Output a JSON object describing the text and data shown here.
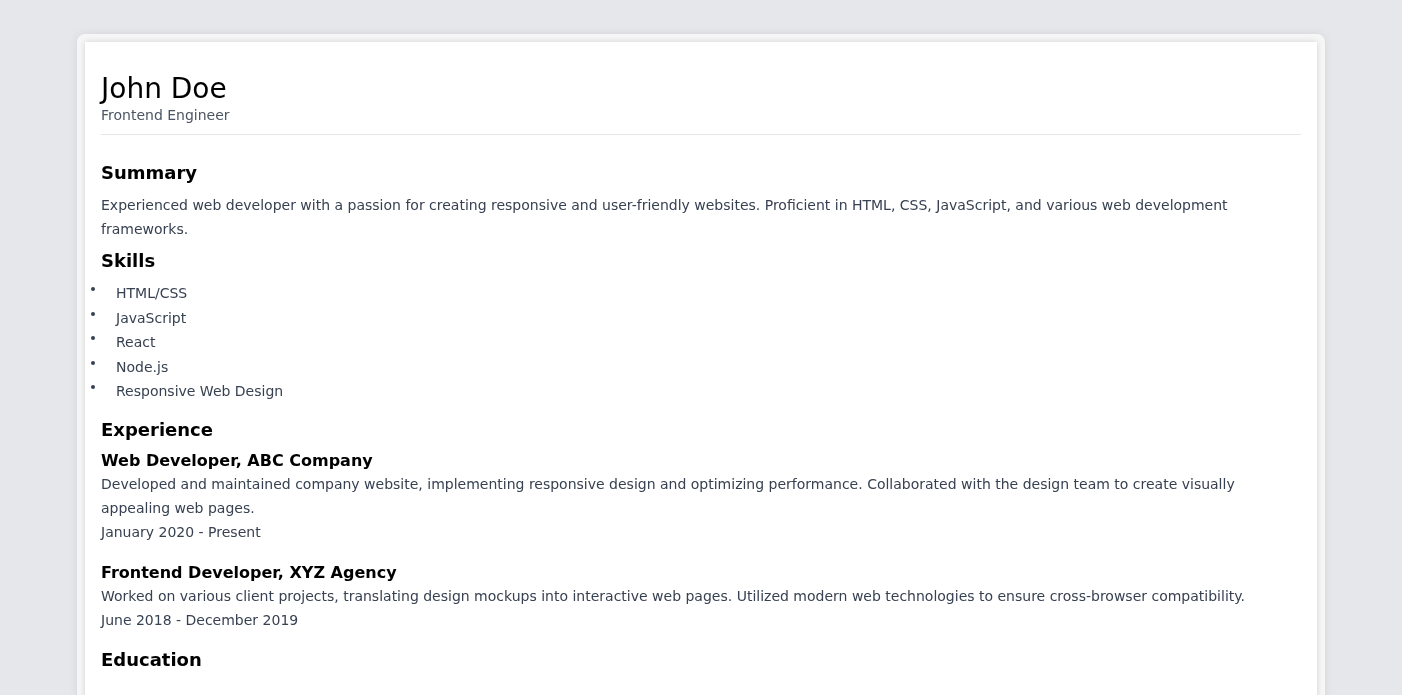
{
  "header": {
    "name": "John Doe",
    "title": "Frontend Engineer"
  },
  "summary": {
    "heading": "Summary",
    "text": "Experienced web developer with a passion for creating responsive and user-friendly websites. Proficient in HTML, CSS, JavaScript, and various web development frameworks."
  },
  "skills": {
    "heading": "Skills",
    "items": [
      "HTML/CSS",
      "JavaScript",
      "React",
      "Node.js",
      "Responsive Web Design"
    ]
  },
  "experience": {
    "heading": "Experience",
    "jobs": [
      {
        "role": "Web Developer, ABC Company",
        "description": "Developed and maintained company website, implementing responsive design and optimizing performance. Collaborated with the design team to create visually appealing web pages.",
        "dates": "January 2020 - Present"
      },
      {
        "role": "Frontend Developer, XYZ Agency",
        "description": "Worked on various client projects, translating design mockups into interactive web pages. Utilized modern web technologies to ensure cross-browser compatibility.",
        "dates": "June 2018 - December 2019"
      }
    ]
  },
  "education": {
    "heading": "Education"
  }
}
